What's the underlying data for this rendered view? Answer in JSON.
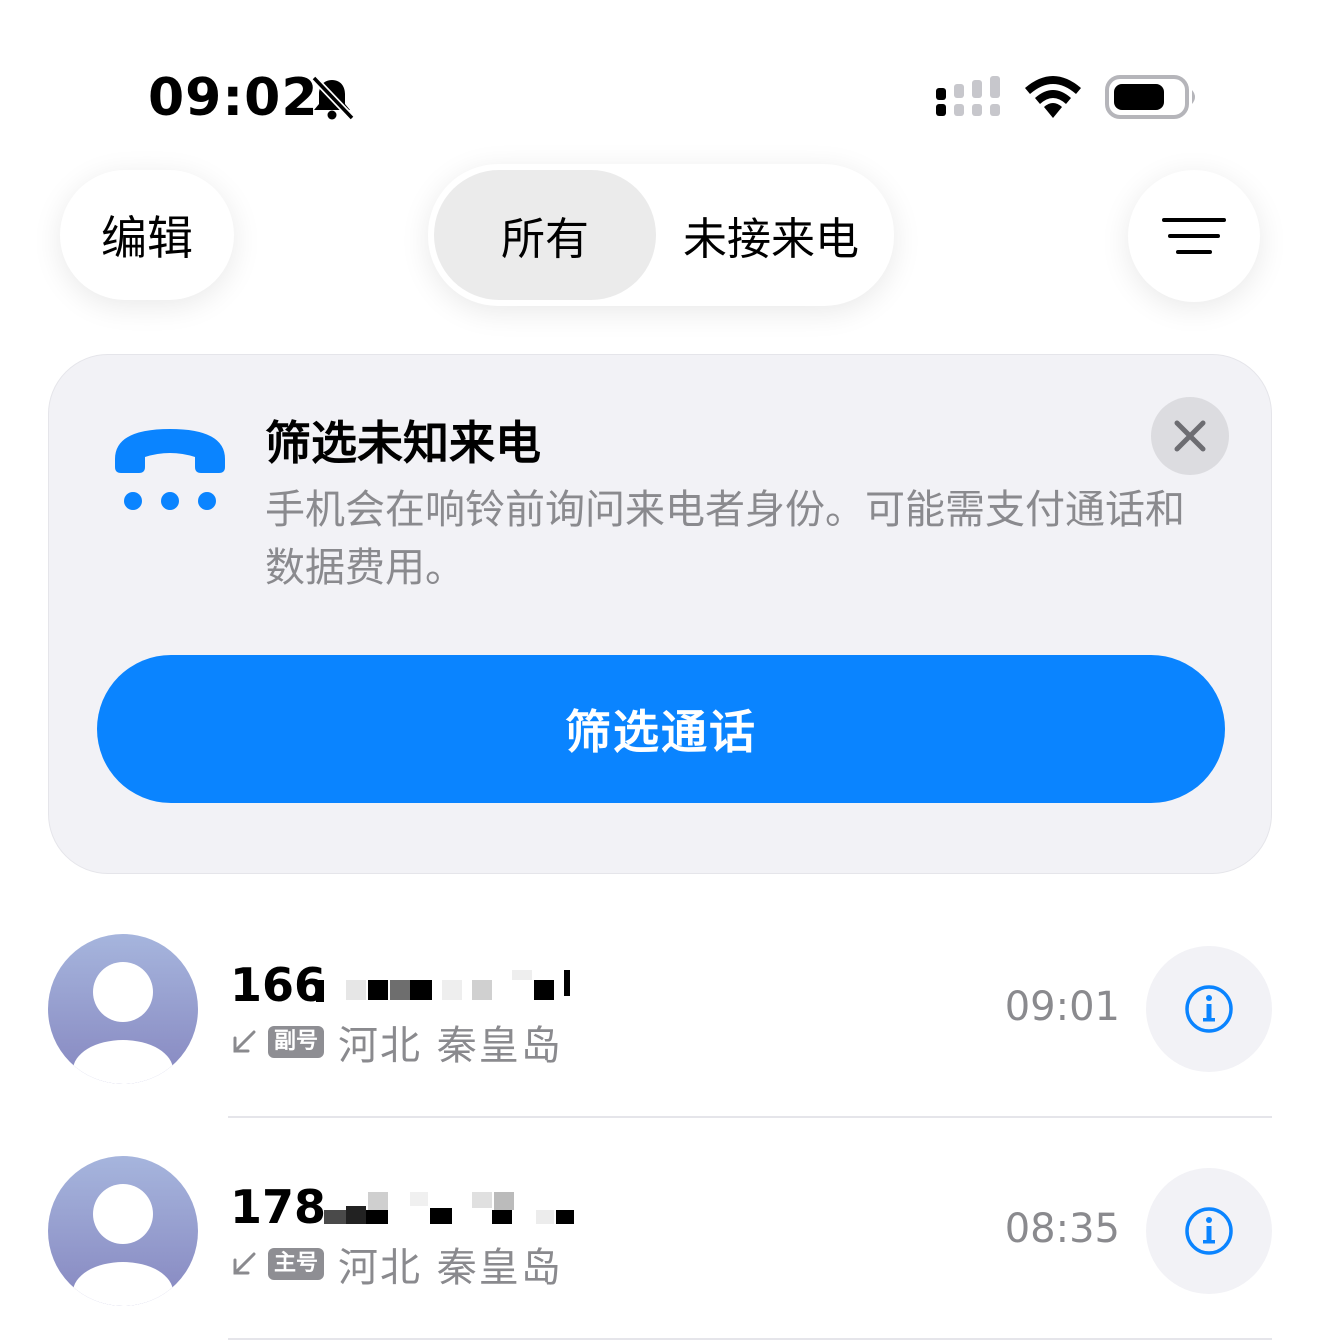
{
  "status_bar": {
    "time": "09:02"
  },
  "top_bar": {
    "edit_label": "编辑",
    "segments": [
      "所有",
      "未接来电"
    ],
    "selected_segment": "所有"
  },
  "banner": {
    "title": "筛选未知来电",
    "description": "手机会在响铃前询问来电者身份。可能需支付通话和数据费用。",
    "button_label": "筛选通话",
    "accent_color": "#0a84ff"
  },
  "calls": [
    {
      "number": "166",
      "sim_label": "副号",
      "location": "河北 秦皇岛",
      "time": "09:01"
    },
    {
      "number": "178",
      "sim_label": "主号",
      "location": "河北 秦皇岛",
      "time": "08:35"
    }
  ]
}
